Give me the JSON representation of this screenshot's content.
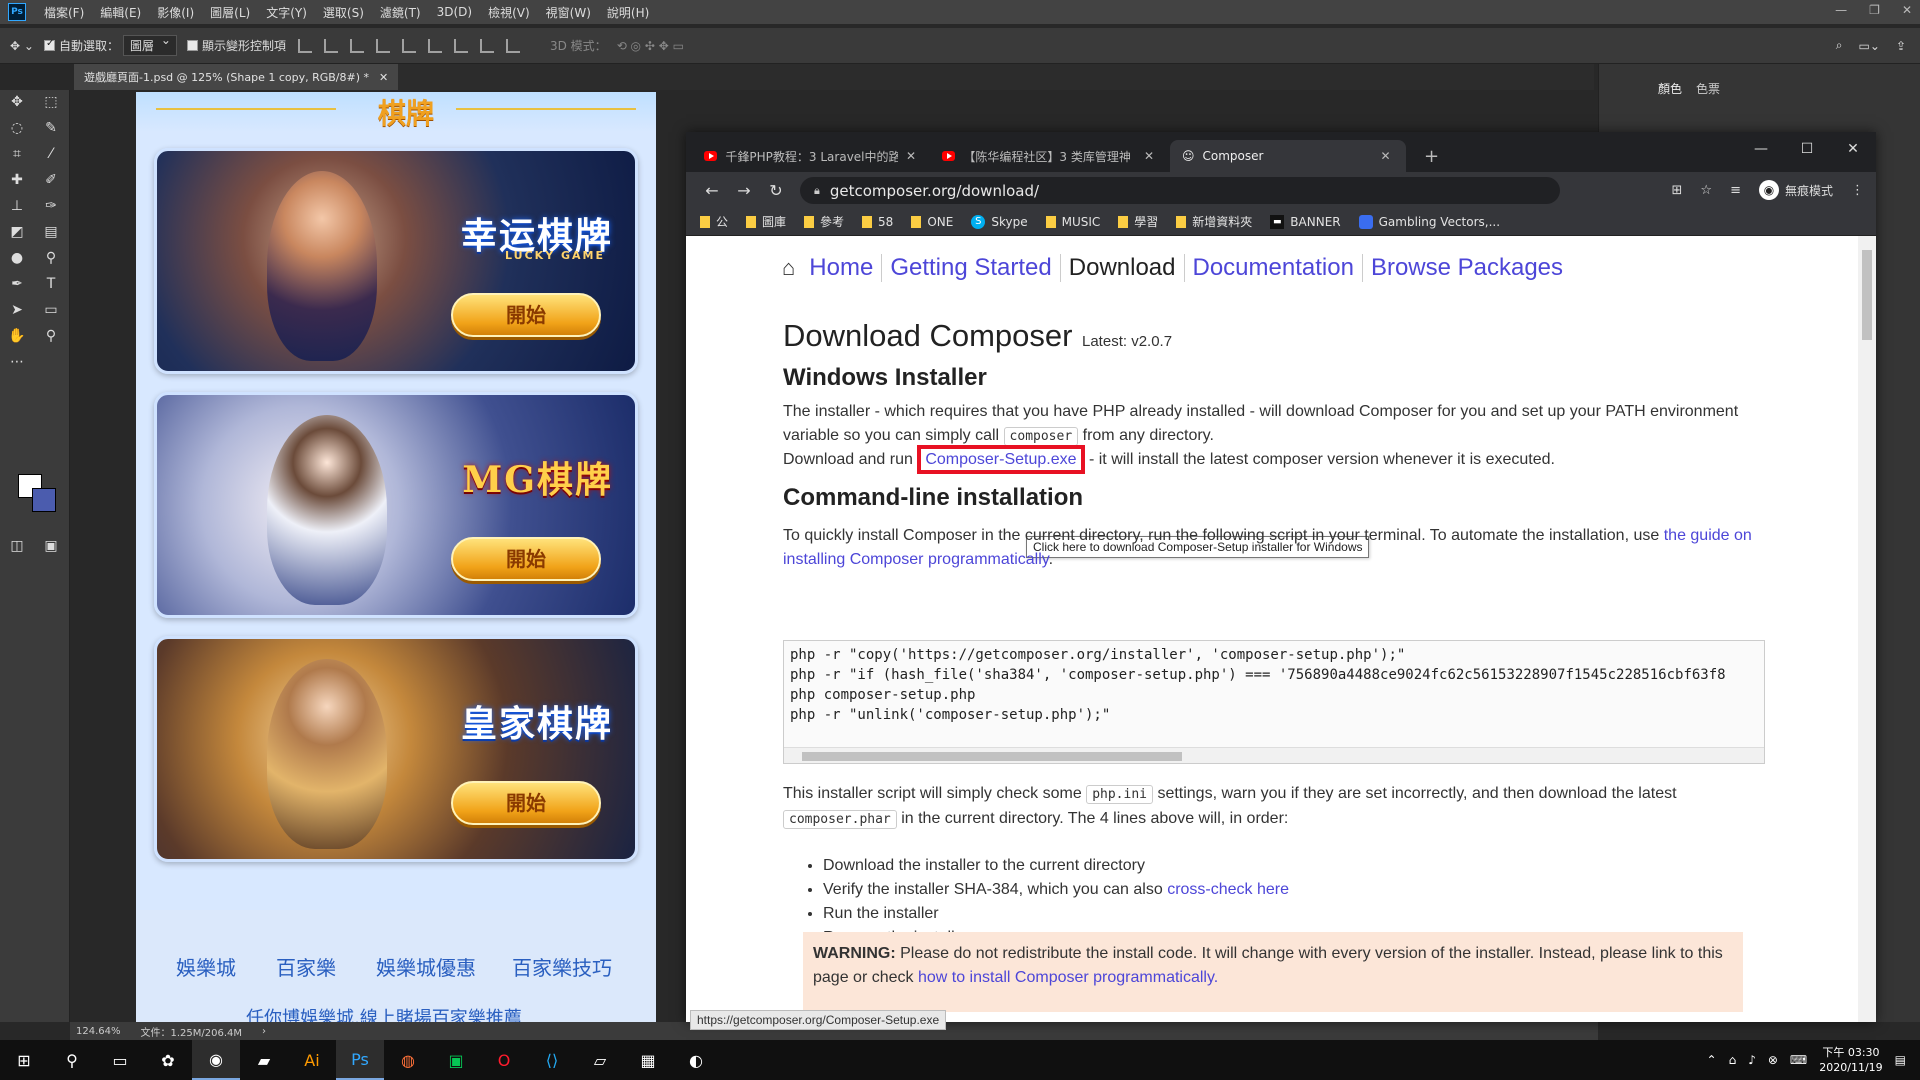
{
  "ps": {
    "menu": [
      "檔案(F)",
      "編輯(E)",
      "影像(I)",
      "圖層(L)",
      "文字(Y)",
      "選取(S)",
      "濾鏡(T)",
      "3D(D)",
      "檢視(V)",
      "視窗(W)",
      "說明(H)"
    ],
    "options": {
      "auto_select": "自動選取：",
      "auto_select_value": "圖層",
      "show_transform": "顯示變形控制項",
      "mode_3d": "3D 模式："
    },
    "doc_tab": "遊戲廳頁面-1.psd @ 125% (Shape 1 copy, RGB/8#) *",
    "panel_tabs": [
      "顏色",
      "色票"
    ],
    "status_zoom": "124.64%",
    "status_doc": "文件：1.25M/206.4M",
    "logo": "Ps",
    "fg_color": "#ffffff",
    "bg_color": "#4b5cae"
  },
  "design": {
    "heading": "棋牌",
    "cards": [
      {
        "brand": "幸运棋牌",
        "sub": "LUCKY GAME",
        "button": "開始"
      },
      {
        "brand": "MG棋牌",
        "sub": "",
        "button": "開始"
      },
      {
        "brand": "皇家棋牌",
        "sub": "",
        "button": "開始"
      }
    ],
    "footer_links": [
      "娛樂城",
      "百家樂",
      "娛樂城優惠",
      "百家樂技巧"
    ],
    "footer_sub": "任你博娛樂城,線上賭場百家樂推薦"
  },
  "chrome": {
    "tabs": [
      {
        "title": "千鋒PHP教程：3 Laravel中的路",
        "active": false
      },
      {
        "title": "【陈华编程社区】3 类库管理神",
        "active": false
      },
      {
        "title": "Composer",
        "active": true
      }
    ],
    "url": "getcomposer.org/download/",
    "incognito": "無痕模式",
    "bookmarks": [
      "公",
      "圖庫",
      "參考",
      "58",
      "ONE",
      "Skype",
      "MUSIC",
      "學習",
      "新增資料夾",
      "BANNER",
      "Gambling Vectors,..."
    ]
  },
  "page": {
    "nav": [
      "Home",
      "Getting Started",
      "Download",
      "Documentation",
      "Browse Packages"
    ],
    "h1": "Download Composer",
    "latest": "Latest: v2.0.7",
    "windows_installer": "Windows Installer",
    "p1a": "The installer - which requires that you have PHP already installed - will download Composer for you and set up your PATH environment variable so you can simply call",
    "p1_code": "composer",
    "p1b": "from any directory.",
    "p2a": "Download and run",
    "p2_link": "Composer-Setup.exe",
    "p2b": "- it will install the latest composer version whenever it is executed.",
    "tooltip": "Click here to download Composer-Setup installer for Windows",
    "cli_heading": "Command-line installation",
    "p3a": "To quickly install Composer in the current directory, run the following script in your terminal. To automate the installation, use",
    "p3_link": "the guide on installing Composer programmatically",
    "code": [
      "php -r \"copy('https://getcomposer.org/installer', 'composer-setup.php');\"",
      "php -r \"if (hash_file('sha384', 'composer-setup.php') === '756890a4488ce9024fc62c56153228907f1545c228516cbf63f8",
      "php composer-setup.php",
      "php -r \"unlink('composer-setup.php');\""
    ],
    "p4a": "This installer script will simply check some",
    "p4_code1": "php.ini",
    "p4b": "settings, warn you if they are set incorrectly, and then download the latest",
    "p4_code2": "composer.phar",
    "p4c": "in the current directory. The 4 lines above will, in order:",
    "list": [
      "Download the installer to the current directory",
      "Verify the installer SHA-384, which you can also",
      "Run the installer",
      "Remove the installer"
    ],
    "crosscheck": "cross-check here",
    "warning_label": "WARNING:",
    "warning_text": "Please do not redistribute the install code. It will change with every version of the installer. Instead, please link to this page or check",
    "warning_link": "how to install Composer programmatically."
  },
  "status_url": "https://getcomposer.org/Composer-Setup.exe",
  "taskbar": {
    "time": "下午 03:30",
    "date": "2020/11/19"
  }
}
